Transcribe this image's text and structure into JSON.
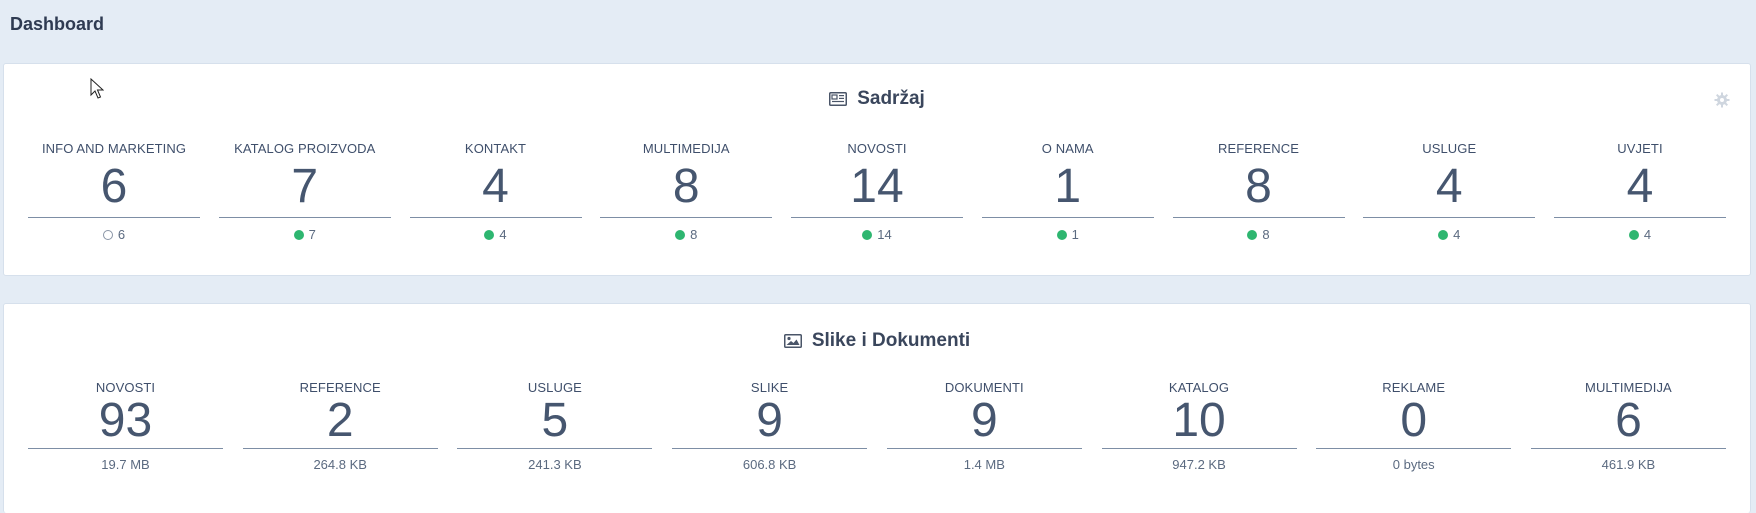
{
  "page": {
    "title": "Dashboard"
  },
  "colors": {
    "background": "#e4ecf5",
    "panel": "#ffffff",
    "text": "#3f4f6b",
    "status_dot": "#2eb670"
  },
  "content_panel": {
    "title": "Sadržaj",
    "icon": "newspaper-icon",
    "settings_icon": "gear-icon",
    "items": [
      {
        "label": "INFO AND MARKETING",
        "count": "6",
        "published": "6",
        "status": "inactive"
      },
      {
        "label": "KATALOG PROIZVODA",
        "count": "7",
        "published": "7",
        "status": "active"
      },
      {
        "label": "KONTAKT",
        "count": "4",
        "published": "4",
        "status": "active"
      },
      {
        "label": "MULTIMEDIJA",
        "count": "8",
        "published": "8",
        "status": "active"
      },
      {
        "label": "NOVOSTI",
        "count": "14",
        "published": "14",
        "status": "active"
      },
      {
        "label": "O NAMA",
        "count": "1",
        "published": "1",
        "status": "active"
      },
      {
        "label": "REFERENCE",
        "count": "8",
        "published": "8",
        "status": "active"
      },
      {
        "label": "USLUGE",
        "count": "4",
        "published": "4",
        "status": "active"
      },
      {
        "label": "UVJETI",
        "count": "4",
        "published": "4",
        "status": "active"
      }
    ]
  },
  "media_panel": {
    "title": "Slike i Dokumenti",
    "icon": "image-icon",
    "items": [
      {
        "label": "NOVOSTI",
        "count": "93",
        "size": "19.7 MB"
      },
      {
        "label": "REFERENCE",
        "count": "2",
        "size": "264.8 KB"
      },
      {
        "label": "USLUGE",
        "count": "5",
        "size": "241.3 KB"
      },
      {
        "label": "SLIKE",
        "count": "9",
        "size": "606.8 KB"
      },
      {
        "label": "DOKUMENTI",
        "count": "9",
        "size": "1.4 MB"
      },
      {
        "label": "KATALOG",
        "count": "10",
        "size": "947.2 KB"
      },
      {
        "label": "REKLAME",
        "count": "0",
        "size": "0 bytes"
      },
      {
        "label": "MULTIMEDIJA",
        "count": "6",
        "size": "461.9 KB"
      }
    ]
  }
}
